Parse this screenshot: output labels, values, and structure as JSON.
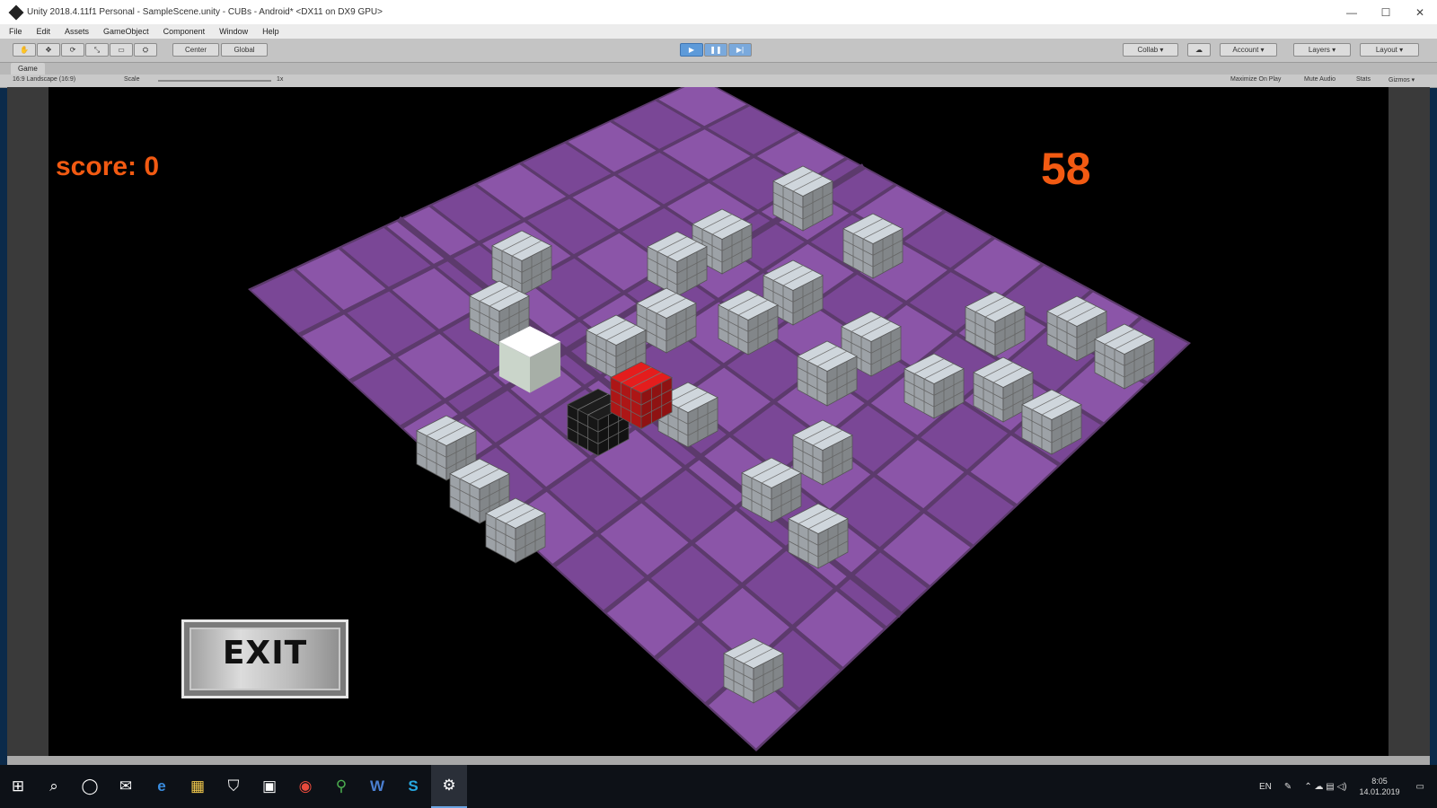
{
  "window": {
    "title": "Unity 2018.4.11f1 Personal - SampleScene.unity - CUBs - Android* <DX11 on DX9 GPU>",
    "controls": [
      "—",
      "☐",
      "✕"
    ]
  },
  "menu": [
    "File",
    "Edit",
    "Assets",
    "GameObject",
    "Component",
    "Window",
    "Help"
  ],
  "toolbar": {
    "tools": [
      "✋",
      "✥",
      "⟳",
      "⤡",
      "▭",
      "⛭"
    ],
    "pivot_label": "Center",
    "space_label": "Global",
    "play_icons": [
      "▶",
      "❚❚",
      "▶|"
    ],
    "collab_label": "Collab ▾",
    "cloud_icon": "☁",
    "account_label": "Account ▾",
    "layers_label": "Layers ▾",
    "layout_label": "Layout ▾"
  },
  "game_tab": {
    "label": "Game",
    "display": "16:9 Landscape (16:9)",
    "scale": "Scale",
    "scale_value": "1x",
    "options": [
      "Maximize On Play",
      "Mute Audio",
      "Stats",
      "Gizmos ▾"
    ]
  },
  "hud": {
    "score": "score: 0",
    "timer": "58",
    "exit_label": "EXIT"
  },
  "scene": {
    "board_color": "#8b55a8",
    "board_dark": "#7a4796",
    "grid_line": "#5c3a6c",
    "cube_color": "#b9bfc4",
    "player_red": "#cc1a1a",
    "player_black": "#1a1a1a",
    "player_white": "#eefaee"
  },
  "taskbar": {
    "icons": [
      "⊞",
      "⌕",
      "◯",
      "✉",
      "e",
      "▦",
      "⛉",
      "▣",
      "◉",
      "⚲",
      "W",
      "S",
      "⚙"
    ],
    "tray_lang": "EN",
    "clock_time": "8:05",
    "clock_date": "14.01.2019"
  }
}
